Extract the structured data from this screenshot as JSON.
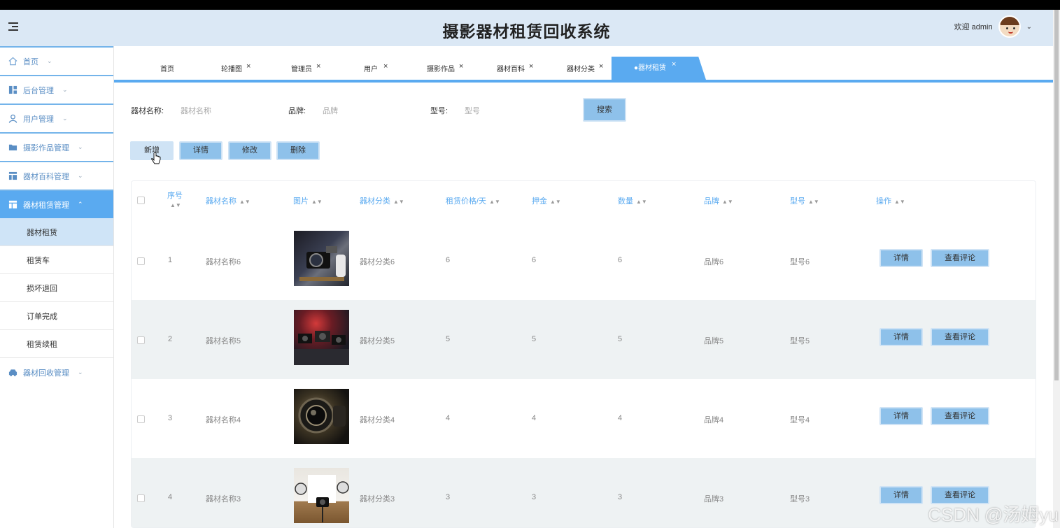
{
  "app": {
    "title": "摄影器材租赁回收系统",
    "welcome": "欢迎 admin"
  },
  "sidebar": {
    "items": [
      {
        "label": "首页",
        "icon": "home-icon"
      },
      {
        "label": "后台管理",
        "icon": "dashboard-icon"
      },
      {
        "label": "用户管理",
        "icon": "user-icon"
      },
      {
        "label": "摄影作品管理",
        "icon": "folder-icon"
      },
      {
        "label": "器材百科管理",
        "icon": "layout-icon"
      },
      {
        "label": "器材租赁管理",
        "icon": "layout-icon",
        "active": true
      },
      {
        "label": "器材回收管理",
        "icon": "car-icon"
      }
    ],
    "subitems": [
      {
        "label": "器材租赁",
        "active": true
      },
      {
        "label": "租赁车"
      },
      {
        "label": "损坏退回"
      },
      {
        "label": "订单完成"
      },
      {
        "label": "租赁续租"
      }
    ]
  },
  "tabs": [
    {
      "label": "首页"
    },
    {
      "label": "轮播图"
    },
    {
      "label": "管理员"
    },
    {
      "label": "用户"
    },
    {
      "label": "摄影作品"
    },
    {
      "label": "器材百科"
    },
    {
      "label": "器材分类"
    },
    {
      "label": "●器材租赁",
      "active": true
    }
  ],
  "search": {
    "name_label": "器材名称:",
    "name_placeholder": "器材名称",
    "brand_label": "品牌:",
    "brand_placeholder": "品牌",
    "model_label": "型号:",
    "model_placeholder": "型号",
    "search_button": "搜索"
  },
  "toolbar": {
    "add": "新增",
    "detail": "详情",
    "edit": "修改",
    "delete": "删除"
  },
  "table": {
    "columns": [
      "序号",
      "器材名称",
      "图片",
      "器材分类",
      "租赁价格/天",
      "押金",
      "数量",
      "品牌",
      "型号",
      "操作"
    ],
    "rows": [
      {
        "index": "1",
        "name": "器材名称6",
        "category": "器材分类6",
        "price": "6",
        "deposit": "6",
        "quantity": "6",
        "brand": "品牌6",
        "model": "型号6"
      },
      {
        "index": "2",
        "name": "器材名称5",
        "category": "器材分类5",
        "price": "5",
        "deposit": "5",
        "quantity": "5",
        "brand": "品牌5",
        "model": "型号5"
      },
      {
        "index": "3",
        "name": "器材名称4",
        "category": "器材分类4",
        "price": "4",
        "deposit": "4",
        "quantity": "4",
        "brand": "品牌4",
        "model": "型号4"
      },
      {
        "index": "4",
        "name": "器材名称3",
        "category": "器材分类3",
        "price": "3",
        "deposit": "3",
        "quantity": "3",
        "brand": "品牌3",
        "model": "型号3"
      }
    ],
    "row_detail": "详情",
    "row_reviews": "查看评论"
  },
  "watermark": "CSDN @汤姆yu",
  "colors": {
    "accent": "#5aaaf0",
    "header_bg": "#dbe8f5",
    "button": "#8ec1ea"
  }
}
